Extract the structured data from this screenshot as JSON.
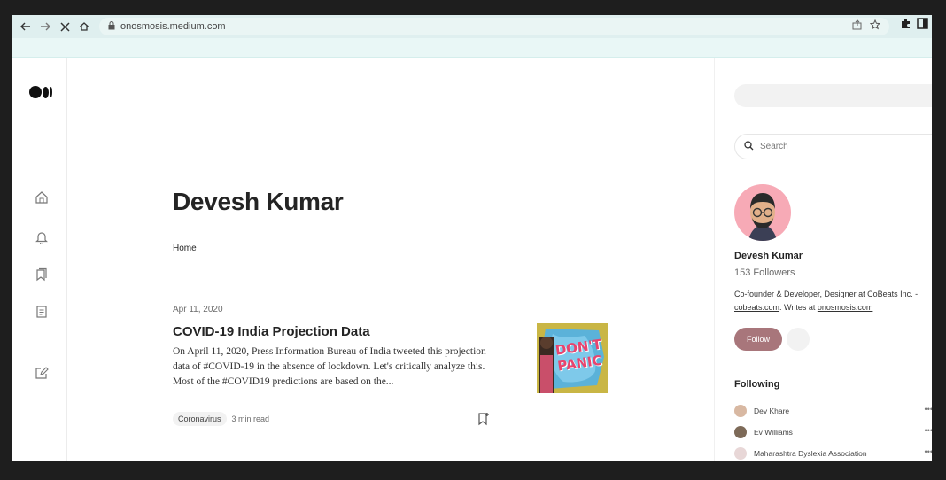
{
  "browser": {
    "url": "onosmosis.medium.com",
    "back_icon": "arrow-left-icon",
    "forward_icon": "arrow-right-icon",
    "stop_icon": "close-icon",
    "home_icon": "home-icon"
  },
  "author": {
    "name": "Devesh Kumar",
    "tabs": [
      {
        "label": "Home"
      }
    ]
  },
  "post": {
    "date": "Apr 11, 2020",
    "title": "COVID-19 India Projection Data",
    "excerpt": "On April 11, 2020, Press Information Bureau of India tweeted this projection data of #COVID-19 in the absence of lockdown. Let's critically analyze this. Most of the #COVID19 predictions are based on the...",
    "tag": "Coronavirus",
    "read_time": "3 min read",
    "thumbnail_text": "DON'T PANIC"
  },
  "sidebar": {
    "search": {
      "placeholder": "Search"
    },
    "profile": {
      "name": "Devesh Kumar",
      "followers": "153 Followers",
      "bio_line1": "Co-founder & Developer, Designer at CoBeats Inc. -",
      "bio_link1": "cobeats.com",
      "bio_mid": ". Writes at ",
      "bio_link2": "onosmosis.com",
      "follow_label": "Follow"
    },
    "following_heading": "Following",
    "following": [
      {
        "name": "Dev Khare"
      },
      {
        "name": "Ev Williams"
      },
      {
        "name": "Maharashtra Dyslexia Association"
      }
    ]
  },
  "colors": {
    "follow_button": "#a8767b",
    "avatar_bg": "#f7aab6",
    "toolbar": "#dfefef"
  }
}
